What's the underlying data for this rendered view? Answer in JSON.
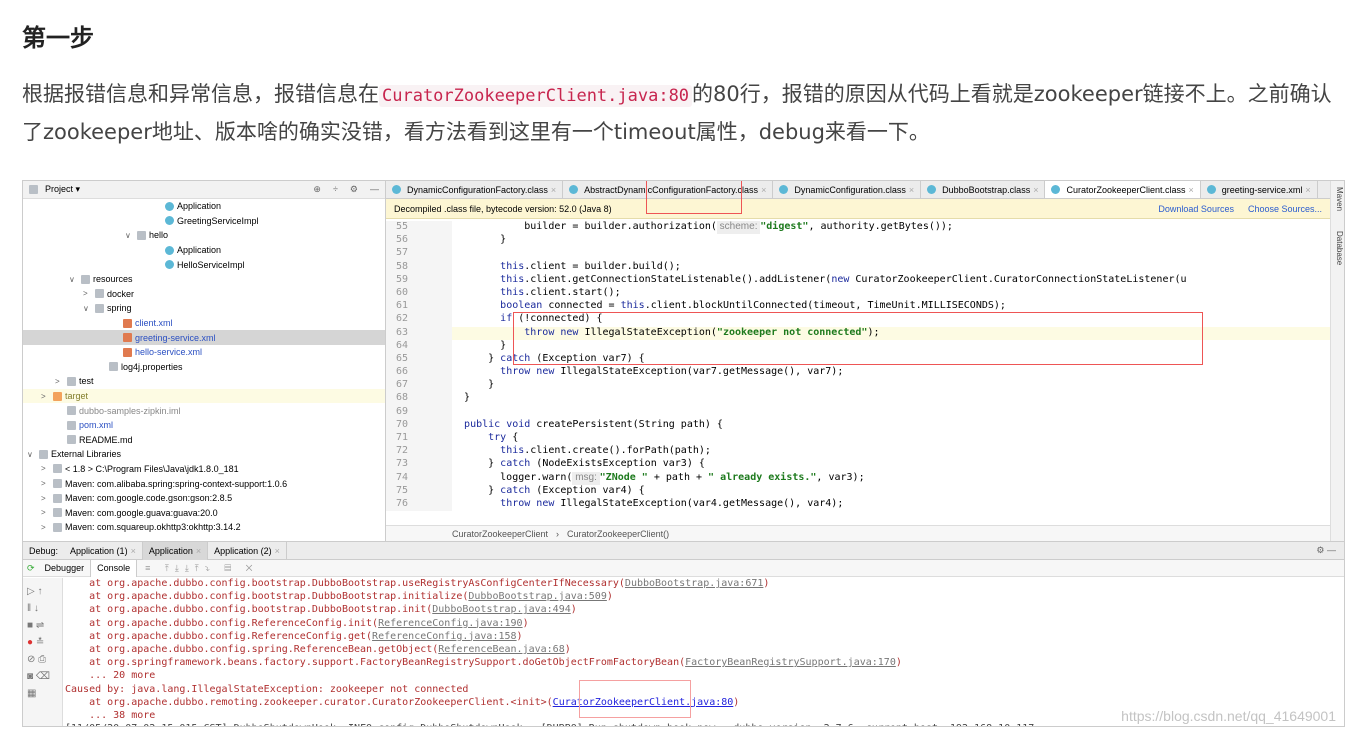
{
  "heading": "第一步",
  "paragraph": {
    "before": "根据报错信息和异常信息，报错信息在",
    "code": "CuratorZookeeperClient.java:80",
    "after": "的80行，报错的原因从代码上看就是zookeeper链接不上。之前确认了zookeeper地址、版本啥的确实没错，看方法看到这里有一个timeout属性，debug来看一下。"
  },
  "project": {
    "title": "Project ▾",
    "tree": [
      {
        "label": "Application",
        "indent": 9,
        "icon": "class",
        "arrow": ""
      },
      {
        "label": "GreetingServiceImpl",
        "indent": 9,
        "icon": "class",
        "arrow": ""
      },
      {
        "label": "hello",
        "indent": 7,
        "icon": "folder",
        "arrow": "∨"
      },
      {
        "label": "Application",
        "indent": 9,
        "icon": "class",
        "arrow": ""
      },
      {
        "label": "HelloServiceImpl",
        "indent": 9,
        "icon": "class",
        "arrow": ""
      },
      {
        "label": "resources",
        "indent": 3,
        "icon": "folder",
        "arrow": "∨"
      },
      {
        "label": "docker",
        "indent": 4,
        "icon": "folder",
        "arrow": ">"
      },
      {
        "label": "spring",
        "indent": 4,
        "icon": "folder",
        "arrow": "∨"
      },
      {
        "label": "client.xml",
        "indent": 6,
        "icon": "xml",
        "arrow": "",
        "color": "blue"
      },
      {
        "label": "greeting-service.xml",
        "indent": 6,
        "icon": "xml",
        "arrow": "",
        "color": "blue",
        "selected": true
      },
      {
        "label": "hello-service.xml",
        "indent": 6,
        "icon": "xml",
        "arrow": "",
        "color": "blue"
      },
      {
        "label": "log4j.properties",
        "indent": 5,
        "icon": "file",
        "arrow": ""
      },
      {
        "label": "test",
        "indent": 2,
        "icon": "folder",
        "arrow": ">"
      },
      {
        "label": "target",
        "indent": 1,
        "icon": "target",
        "arrow": ">",
        "color": "olive",
        "highlight": true
      },
      {
        "label": "dubbo-samples-zipkin.iml",
        "indent": 2,
        "icon": "file",
        "arrow": "",
        "color": "gray"
      },
      {
        "label": "pom.xml",
        "indent": 2,
        "icon": "file",
        "arrow": "",
        "color": "blue"
      },
      {
        "label": "README.md",
        "indent": 2,
        "icon": "file",
        "arrow": ""
      },
      {
        "label": "External Libraries",
        "indent": 0,
        "icon": "lib",
        "arrow": "∨"
      },
      {
        "label": "< 1.8 >  C:\\Program Files\\Java\\jdk1.8.0_181",
        "indent": 1,
        "icon": "lib",
        "arrow": ">"
      },
      {
        "label": "Maven: com.alibaba.spring:spring-context-support:1.0.6",
        "indent": 1,
        "icon": "lib",
        "arrow": ">"
      },
      {
        "label": "Maven: com.google.code.gson:gson:2.8.5",
        "indent": 1,
        "icon": "lib",
        "arrow": ">"
      },
      {
        "label": "Maven: com.google.guava:guava:20.0",
        "indent": 1,
        "icon": "lib",
        "arrow": ">"
      },
      {
        "label": "Maven: com.squareup.okhttp3:okhttp:3.14.2",
        "indent": 1,
        "icon": "lib",
        "arrow": ">"
      }
    ]
  },
  "editor": {
    "tabs": [
      {
        "label": "DynamicConfigurationFactory.class"
      },
      {
        "label": "AbstractDynamicConfigurationFactory.class"
      },
      {
        "label": "DynamicConfiguration.class"
      },
      {
        "label": "DubboBootstrap.class"
      },
      {
        "label": "CuratorZookeeperClient.class",
        "active": true
      },
      {
        "label": "greeting-service.xml"
      }
    ],
    "notice": "Decompiled .class file, bytecode version: 52.0 (Java 8)",
    "download_sources": "Download Sources",
    "choose_sources": "Choose Sources...",
    "lines": [
      {
        "n": "55",
        "t": [
          [
            "            builder = builder.authorization(",
            ""
          ],
          [
            " scheme: ",
            "hint"
          ],
          [
            "\"digest\"",
            "st"
          ],
          [
            ", authority.getBytes());",
            ""
          ]
        ]
      },
      {
        "n": "56",
        "t": [
          [
            "        }",
            ""
          ]
        ]
      },
      {
        "n": "57",
        "t": []
      },
      {
        "n": "58",
        "t": [
          [
            "        ",
            ""
          ],
          [
            "this",
            "kw"
          ],
          [
            ".client = builder.build();",
            ""
          ]
        ]
      },
      {
        "n": "59",
        "t": [
          [
            "        ",
            ""
          ],
          [
            "this",
            "kw"
          ],
          [
            ".client.getConnectionStateListenable().addListener(",
            ""
          ],
          [
            "new",
            "kw"
          ],
          [
            " CuratorZookeeperClient.CuratorConnectionStateListener(u",
            ""
          ]
        ]
      },
      {
        "n": "60",
        "t": [
          [
            "        ",
            ""
          ],
          [
            "this",
            "kw"
          ],
          [
            ".client.start();",
            ""
          ]
        ]
      },
      {
        "n": "61",
        "t": [
          [
            "        ",
            ""
          ],
          [
            "boolean",
            "kw"
          ],
          [
            " connected = ",
            ""
          ],
          [
            "this",
            "kw"
          ],
          [
            ".client.blockUntilConnected(timeout, TimeUnit.MILLISECONDS);",
            ""
          ]
        ]
      },
      {
        "n": "62",
        "t": [
          [
            "        ",
            ""
          ],
          [
            "if",
            "kw"
          ],
          [
            " (!connected) {",
            ""
          ]
        ]
      },
      {
        "n": "63",
        "t": [
          [
            "            ",
            ""
          ],
          [
            "throw new",
            "kw"
          ],
          [
            " IllegalStateException(",
            ""
          ],
          [
            "\"zookeeper not connected\"",
            "st"
          ],
          [
            ");",
            ""
          ]
        ],
        "current": true
      },
      {
        "n": "64",
        "t": [
          [
            "        }",
            ""
          ]
        ]
      },
      {
        "n": "65",
        "t": [
          [
            "      } ",
            ""
          ],
          [
            "catch",
            "kw"
          ],
          [
            " (Exception var7) {",
            ""
          ]
        ]
      },
      {
        "n": "66",
        "t": [
          [
            "        ",
            ""
          ],
          [
            "throw new",
            "kw"
          ],
          [
            " IllegalStateException(var7.getMessage(), var7);",
            ""
          ]
        ]
      },
      {
        "n": "67",
        "t": [
          [
            "      }",
            ""
          ]
        ]
      },
      {
        "n": "68",
        "t": [
          [
            "  }",
            ""
          ]
        ]
      },
      {
        "n": "69",
        "t": []
      },
      {
        "n": "70",
        "t": [
          [
            "  ",
            ""
          ],
          [
            "public void",
            "kw"
          ],
          [
            " createPersistent(String path) {",
            ""
          ]
        ]
      },
      {
        "n": "71",
        "t": [
          [
            "      ",
            ""
          ],
          [
            "try",
            "kw"
          ],
          [
            " {",
            ""
          ]
        ]
      },
      {
        "n": "72",
        "t": [
          [
            "        ",
            ""
          ],
          [
            "this",
            "kw"
          ],
          [
            ".client.create().forPath(path);",
            ""
          ]
        ]
      },
      {
        "n": "73",
        "t": [
          [
            "      } ",
            ""
          ],
          [
            "catch",
            "kw"
          ],
          [
            " (NodeExistsException var3) {",
            ""
          ]
        ]
      },
      {
        "n": "74",
        "t": [
          [
            "        logger.warn(",
            ""
          ],
          [
            " msg: ",
            "hint"
          ],
          [
            "\"ZNode \"",
            "st"
          ],
          [
            " + path + ",
            ""
          ],
          [
            "\" already exists.\"",
            "st"
          ],
          [
            ", var3);",
            ""
          ]
        ]
      },
      {
        "n": "75",
        "t": [
          [
            "      } ",
            ""
          ],
          [
            "catch",
            "kw"
          ],
          [
            " (Exception var4) {",
            ""
          ]
        ]
      },
      {
        "n": "76",
        "t": [
          [
            "        ",
            ""
          ],
          [
            "throw new",
            "kw"
          ],
          [
            " IllegalStateException(var4.getMessage(), var4);",
            ""
          ]
        ]
      }
    ],
    "breadcrumb": [
      "CuratorZookeeperClient",
      "CuratorZookeeperClient()"
    ],
    "side": [
      "Maven",
      "Database"
    ]
  },
  "debug": {
    "label": "Debug:",
    "tabs": [
      "Application (1)",
      "Application",
      "Application (2)"
    ],
    "debugger": "Debugger",
    "console": "Console",
    "console_lines": [
      {
        "pre": "    at org.apache.dubbo.config.bootstrap.DubboBootstrap.useRegistryAsConfigCenterIfNecessary(",
        "src": "DubboBootstrap.java:671",
        "post": ")"
      },
      {
        "pre": "    at org.apache.dubbo.config.bootstrap.DubboBootstrap.initialize(",
        "src": "DubboBootstrap.java:509",
        "post": ")"
      },
      {
        "pre": "    at org.apache.dubbo.config.bootstrap.DubboBootstrap.init(",
        "src": "DubboBootstrap.java:494",
        "post": ")"
      },
      {
        "pre": "    at org.apache.dubbo.config.ReferenceConfig.init(",
        "src": "ReferenceConfig.java:190",
        "post": ")"
      },
      {
        "pre": "    at org.apache.dubbo.config.ReferenceConfig.get(",
        "src": "ReferenceConfig.java:158",
        "post": ")"
      },
      {
        "pre": "    at org.apache.dubbo.config.spring.ReferenceBean.getObject(",
        "src": "ReferenceBean.java:68",
        "post": ")"
      },
      {
        "pre": "    at org.springframework.beans.factory.support.FactoryBeanRegistrySupport.doGetObjectFromFactoryBean(",
        "src": "FactoryBeanRegistrySupport.java:170",
        "post": ")"
      },
      {
        "pre": "    ... 20 more",
        "src": "",
        "post": ""
      },
      {
        "pre": "Caused by: java.lang.IllegalStateException: zookeeper not connected",
        "src": "",
        "post": ""
      },
      {
        "pre": "    at org.apache.dubbo.remoting.zookeeper.curator.CuratorZookeeperClient.<init>(",
        "src": "CuratorZookeeperClient.java:80",
        "post": ")",
        "link": true
      },
      {
        "pre": "    ... 38 more",
        "src": "",
        "post": ""
      },
      {
        "pre": "[11/05/20 07:02:15:015 CST] DubboShutdownHook  INFO config.DubboShutdownHook:  [DUBBO] Run shutdown hook now., dubbo version: 2.7.6, current host: 192.168.10.117",
        "src": "",
        "post": ""
      }
    ]
  },
  "watermark": "https://blog.csdn.net/qq_41649001",
  "colors": {
    "highlight_box": "#e55555",
    "keyword": "#1b2a9c",
    "string": "#1d7a1d",
    "error_text": "#b03030"
  }
}
